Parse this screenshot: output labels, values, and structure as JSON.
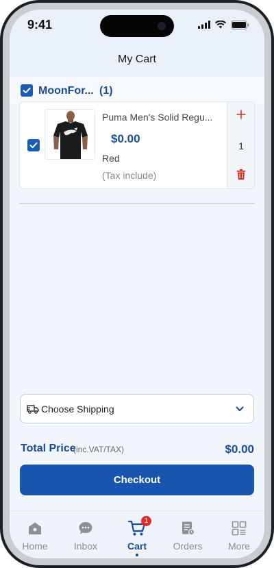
{
  "status_bar": {
    "time": "9:41"
  },
  "header": {
    "title": "My Cart"
  },
  "shop": {
    "name": "MoonFor...",
    "count": "(1)",
    "selected": true
  },
  "cart_items": [
    {
      "title": "Puma Men's Solid Regu...",
      "price": "$0.00",
      "variant": "Red",
      "tax_note": "(Tax include)",
      "quantity": "1",
      "selected": true
    }
  ],
  "shipping": {
    "label": "Choose Shipping"
  },
  "total": {
    "label": "Total Price",
    "note": "(inc.VAT/TAX)",
    "value": "$0.00"
  },
  "checkout": {
    "label": "Checkout"
  },
  "bottom_nav": {
    "items": [
      {
        "label": "Home",
        "icon": "home-icon"
      },
      {
        "label": "Inbox",
        "icon": "chat-icon"
      },
      {
        "label": "Cart",
        "icon": "cart-icon",
        "badge": "1",
        "active": true
      },
      {
        "label": "Orders",
        "icon": "orders-icon"
      },
      {
        "label": "More",
        "icon": "grid-icon"
      }
    ]
  },
  "colors": {
    "accent": "#1c4b97",
    "button": "#1855b0",
    "danger": "#d93025"
  }
}
